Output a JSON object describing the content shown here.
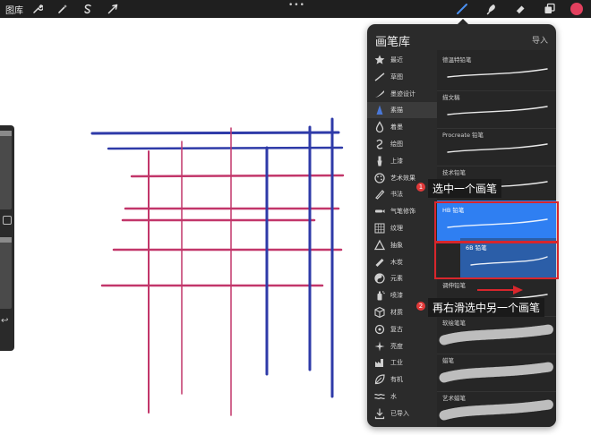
{
  "topbar": {
    "gallery_label": "图库",
    "left_tools": [
      "wrench-icon",
      "magic-wand-icon",
      "selection-icon",
      "transform-arrow-icon"
    ],
    "more_dots": "•••",
    "right_tools": [
      "brush-icon",
      "smudge-icon",
      "eraser-icon",
      "layers-icon"
    ],
    "active_tool": "brush-icon",
    "current_color": "#e2405e"
  },
  "sidebar": {
    "undo_icon": "↩"
  },
  "brush_library": {
    "title": "画笔库",
    "import_label": "导入",
    "categories": [
      {
        "label": "最近",
        "icon": "star-icon"
      },
      {
        "label": "草图",
        "icon": "sketch-icon"
      },
      {
        "label": "墨迹设计",
        "icon": "ink-icon"
      },
      {
        "label": "素描",
        "icon": "pencil-tip-icon",
        "active": true
      },
      {
        "label": "着墨",
        "icon": "ink-drop-icon"
      },
      {
        "label": "绘图",
        "icon": "swirl-icon"
      },
      {
        "label": "上漆",
        "icon": "paint-brush-icon"
      },
      {
        "label": "艺术效果",
        "icon": "palette-icon"
      },
      {
        "label": "书法",
        "icon": "calligraphy-icon"
      },
      {
        "label": "气笔修饰",
        "icon": "airbrush-icon"
      },
      {
        "label": "纹理",
        "icon": "texture-icon"
      },
      {
        "label": "抽象",
        "icon": "triangle-icon"
      },
      {
        "label": "木炭",
        "icon": "charcoal-icon"
      },
      {
        "label": "元素",
        "icon": "yin-yang-icon"
      },
      {
        "label": "喷漆",
        "icon": "spray-icon"
      },
      {
        "label": "材质",
        "icon": "cube-icon"
      },
      {
        "label": "复古",
        "icon": "retro-icon"
      },
      {
        "label": "亮度",
        "icon": "sparkle-icon"
      },
      {
        "label": "工业",
        "icon": "industrial-icon"
      },
      {
        "label": "有机",
        "icon": "leaf-icon"
      },
      {
        "label": "水",
        "icon": "water-icon"
      },
      {
        "label": "已导入",
        "icon": "import-icon"
      }
    ],
    "brushes": [
      {
        "name": "德温特铅笔",
        "stroke": "thin"
      },
      {
        "name": "描文稿",
        "stroke": "thin"
      },
      {
        "name": "Procreate 铅笔",
        "stroke": "thin"
      },
      {
        "name": "技术铅笔",
        "stroke": "thin"
      },
      {
        "name": "HB 铅笔",
        "stroke": "thin",
        "selected": true
      },
      {
        "name": "6B 铅笔",
        "stroke": "thin",
        "selected": true
      },
      {
        "name": "调伸铅笔",
        "stroke": "thin"
      },
      {
        "name": "软绘笔笔",
        "stroke": "texture"
      },
      {
        "name": "蜡笔",
        "stroke": "texture"
      },
      {
        "name": "艺术蜡笔",
        "stroke": "texture"
      }
    ]
  },
  "annotations": {
    "step1_badge": "1",
    "step1_text": "选中一个画笔",
    "step2_badge": "2",
    "step2_text": "再右滑选中另一个画笔"
  },
  "colors": {
    "ink_blue": "#2e3aa8",
    "ink_pink": "#c2366a",
    "highlight_red": "#d8262c",
    "selected_blue": "#2f7ff2",
    "selected_blue_dark": "#2b5ea8"
  }
}
